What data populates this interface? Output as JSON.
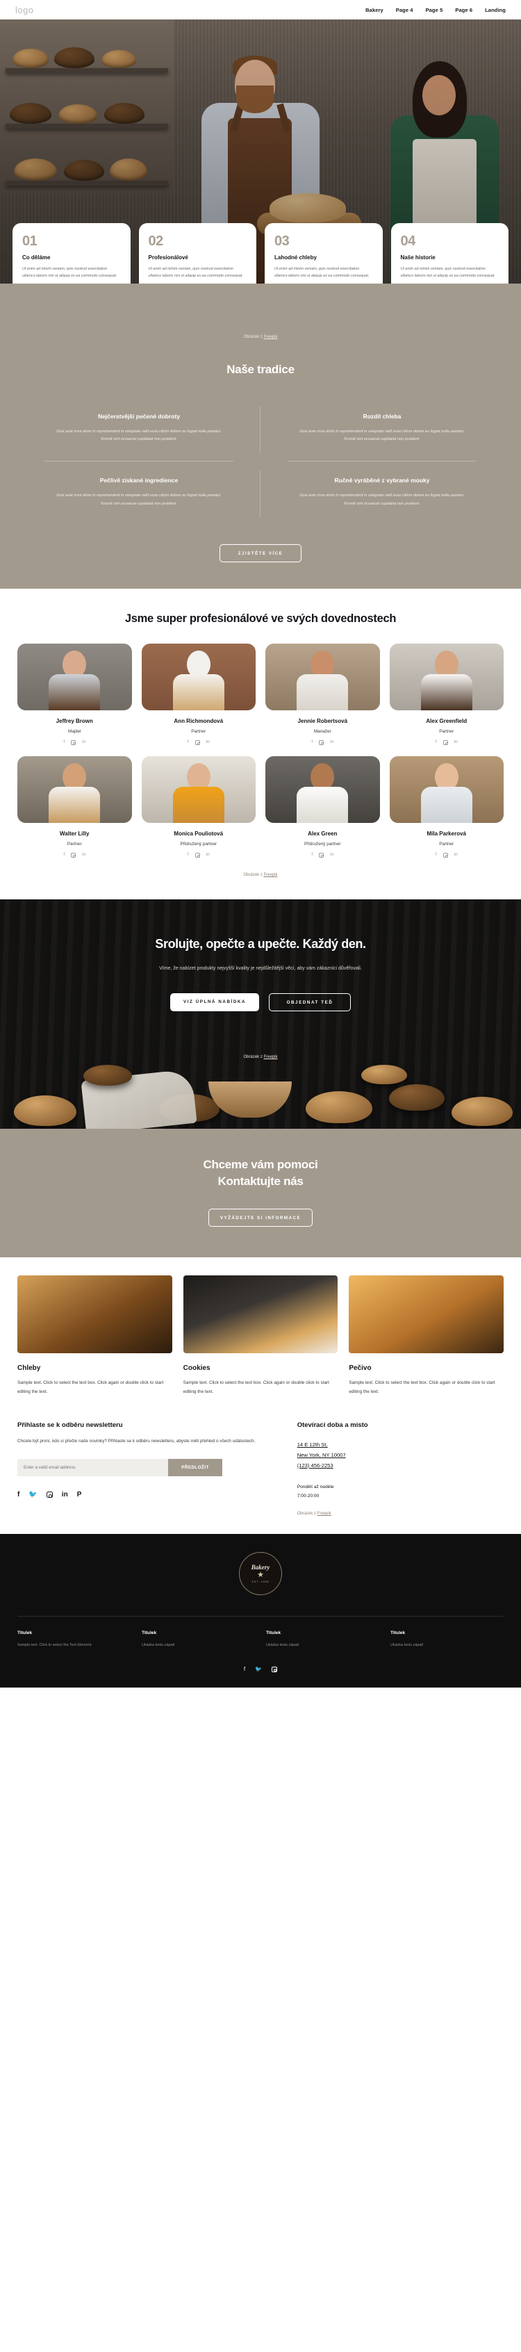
{
  "header": {
    "logo": "logo",
    "nav": [
      {
        "label": "Bakery"
      },
      {
        "label": "Page 4"
      },
      {
        "label": "Page 5"
      },
      {
        "label": "Page 6"
      },
      {
        "label": "Landing"
      }
    ]
  },
  "hero_cards": [
    {
      "num": "01",
      "title": "Co děláme",
      "text": "Ut enim ad minim veniam, quis nostrud exercitation ullamco laboris nisi ut aliquip ex ea commodo consequat."
    },
    {
      "num": "02",
      "title": "Profesionálové",
      "text": "Ut enim ad minim veniam, quis nostrud exercitation ullamco laboris nisi ut aliquip ex ea commodo consequat."
    },
    {
      "num": "03",
      "title": "Lahodné chleby",
      "text": "Ut enim ad minim veniam, quis nostrud exercitation ullamco laboris nisi ut aliquip ex ea commodo consequat."
    },
    {
      "num": "04",
      "title": "Naše historie",
      "text": "Ut enim ad minim veniam, quis nostrud exercitation ullamco laboris nisi ut aliquip ex ea commodo consequat."
    }
  ],
  "credit": {
    "prefix": "Obrázek z ",
    "link": "Freepik"
  },
  "tradition": {
    "title": "Naše tradice",
    "items": [
      {
        "title": "Nejčerstvější pečené dobroty",
        "text": "Duis aute irure dolor in reprehenderit in voluptate velit esse cillum dolore eu fugiat nulla pariatur. Kromě sint occaecat cupidatat non proident."
      },
      {
        "title": "Rozdíl chleba",
        "text": "Duis aute irure dolor in reprehenderit in voluptate velit esse cillum dolore eu fugiat nulla pariatur. Kromě sint occaecat cupidatat non proident."
      },
      {
        "title": "Pečlivě získané ingredience",
        "text": "Duis aute irure dolor in reprehenderit in voluptate velit esse cillum dolore eu fugiat nulla pariatur. Kromě sint occaecat cupidatat non proident."
      },
      {
        "title": "Ručně vyráběné z vybrané mouky",
        "text": "Duis aute irure dolor in reprehenderit in voluptate velit esse cillum dolore eu fugiat nulla pariatur. Kromě sint occaecat cupidatat non proident."
      }
    ],
    "button": "ZJISTĚTE VÍCE"
  },
  "team": {
    "title": "Jsme super profesionálové ve svých dovednostech",
    "members": [
      {
        "name": "Jeffrey Brown",
        "role": "Majitel"
      },
      {
        "name": "Ann Richmondová",
        "role": "Partner"
      },
      {
        "name": "Jennie Robertsová",
        "role": "Manažer"
      },
      {
        "name": "Alex Greenfield",
        "role": "Partner"
      },
      {
        "name": "Walter Lilly",
        "role": "Partner"
      },
      {
        "name": "Monica Pouliotová",
        "role": "Přidružený partner"
      },
      {
        "name": "Alex Green",
        "role": "Přidružený partner"
      },
      {
        "name": "Míla Parkerová",
        "role": "Partner"
      }
    ],
    "social": [
      "f",
      "instagram",
      "in"
    ]
  },
  "cta": {
    "title": "Srolujte, opečte a upečte. Každý den.",
    "subtitle": "Víme, že nabízet produkty nejvyšší kvality je nejdůležitější věcí, aby vám zákazníci důvěřovali.",
    "primary_button": "VIZ ÚPLNÁ NABÍDKA",
    "secondary_button": "OBJEDNAT TEĎ"
  },
  "contact": {
    "title_line1": "Chceme vám pomoci",
    "title_line2": "Kontaktujte nás",
    "button": "VYŽÁDEJTE SI INFORMACE"
  },
  "products": [
    {
      "title": "Chleby",
      "text": "Sample text. Click to select the text box. Click again or double click to start editing the text."
    },
    {
      "title": "Cookies",
      "text": "Sample text. Click to select the text box. Click again or double click to start editing the text."
    },
    {
      "title": "Pečivo",
      "text": "Sample text. Click to select the text box. Click again or double click to start editing the text."
    }
  ],
  "newsletter": {
    "title": "Přihlaste se k odběru newsletteru",
    "text": "Chcete být první, kdo si přečte naše novinky? Přihlaste se k odběru newsletteru, abyste měli přehled o všech událostech.",
    "placeholder": "Enter a valid email address",
    "button": "PŘEDLOŽIT",
    "social": [
      "f",
      "twitter",
      "instagram",
      "in",
      "pinterest"
    ]
  },
  "hours": {
    "title": "Otevírací doba a místo",
    "address_line1": "14 E 12th St,",
    "address_line2": "New York, NY 10007",
    "phone": "(123) 456-2253",
    "days": "Pondělí až neděle",
    "time": "7:00-20:00"
  },
  "footer": {
    "brand_top": "Bakery",
    "brand_bottom": "EST. 1998",
    "columns": [
      {
        "title": "Titulek",
        "text": "Sample text. Click to select the Text Element."
      },
      {
        "title": "Titulek",
        "text": "Ukázka textu zápatí"
      },
      {
        "title": "Titulek",
        "text": "Ukázka textu zápatí"
      },
      {
        "title": "Titulek",
        "text": "Ukázka textu zápatí"
      }
    ],
    "social": [
      "f",
      "twitter",
      "instagram"
    ]
  },
  "colors": {
    "tan": "#a39a8e",
    "dark": "#151413",
    "accent": "#a2998d"
  }
}
